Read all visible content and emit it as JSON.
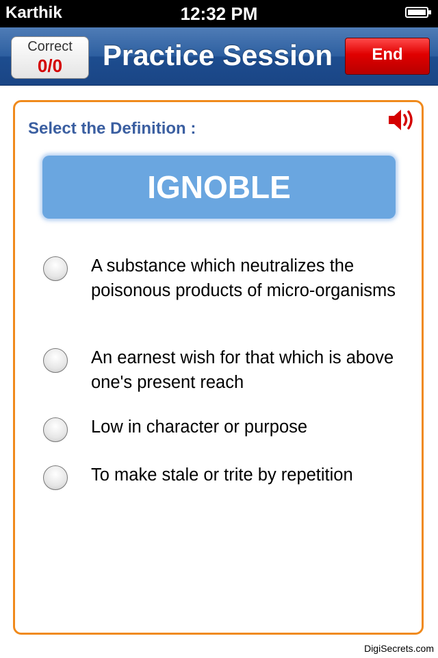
{
  "status_bar": {
    "carrier": "Karthik",
    "time": "12:32 PM"
  },
  "nav": {
    "correct_label": "Correct",
    "correct_value": "0/0",
    "title": "Practice Session",
    "end_label": "End"
  },
  "card": {
    "prompt": "Select the Definition :",
    "word": "IGNOBLE",
    "options": [
      {
        "text": "A substance which neutralizes the poisonous products of micro-organisms"
      },
      {
        "text": "An earnest wish for that which is above one's present reach"
      },
      {
        "text": "Low in character or purpose"
      },
      {
        "text": "To make stale or trite by repetition"
      }
    ],
    "speaker_icon": "speaker-icon"
  },
  "footer": {
    "credit": "DigiSecrets.com"
  },
  "colors": {
    "accent_orange": "#f08a1c",
    "nav_blue": "#2d5fa0",
    "end_red": "#e00000",
    "word_box_blue": "#6aa6e0",
    "prompt_blue": "#3b5fa1"
  }
}
